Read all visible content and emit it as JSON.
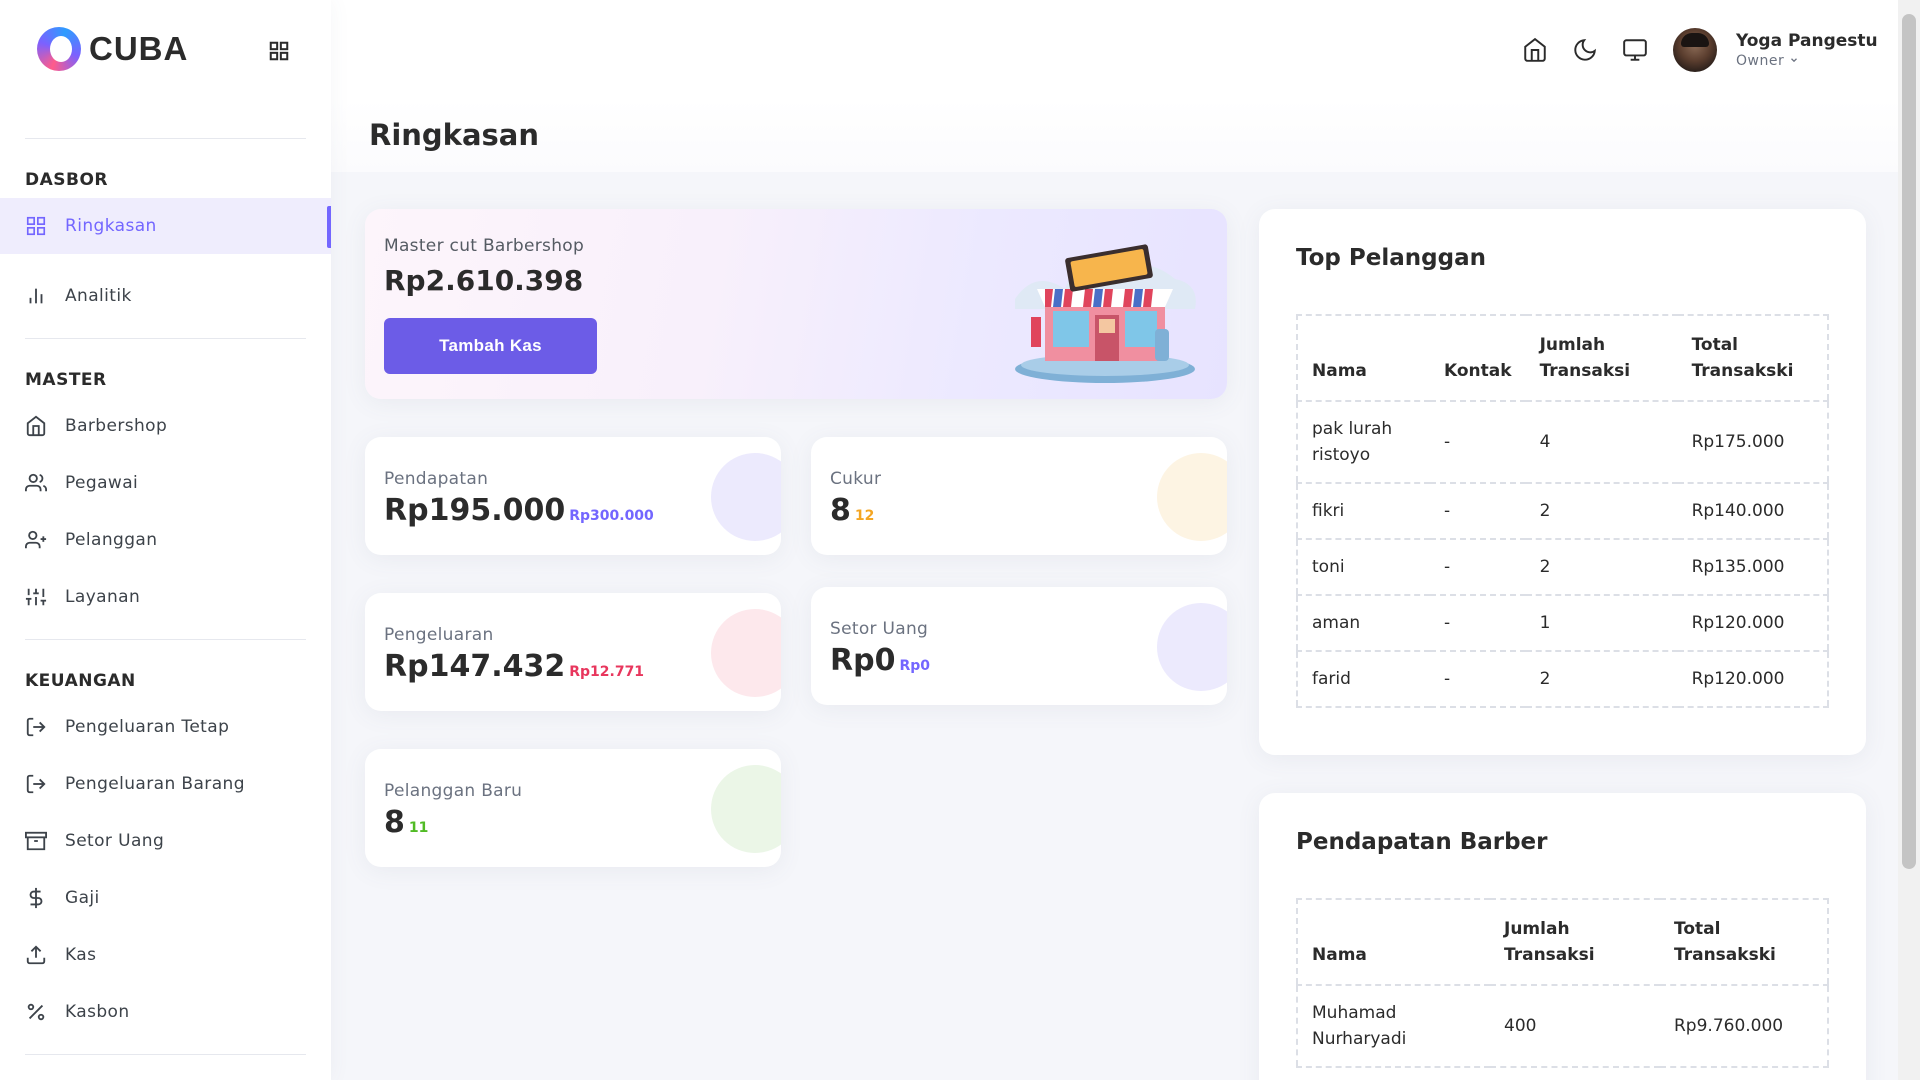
{
  "brand": {
    "name": "CUBA"
  },
  "sidebar": {
    "sections": [
      {
        "title": "DASBOR",
        "items": [
          {
            "label": "Ringkasan",
            "icon": "grid-icon",
            "active": true
          },
          {
            "label": "Analitik",
            "icon": "bar-chart-icon"
          }
        ]
      },
      {
        "title": "MASTER",
        "items": [
          {
            "label": "Barbershop",
            "icon": "home-icon"
          },
          {
            "label": "Pegawai",
            "icon": "users-icon"
          },
          {
            "label": "Pelanggan",
            "icon": "user-plus-icon"
          },
          {
            "label": "Layanan",
            "icon": "sliders-icon"
          }
        ]
      },
      {
        "title": "KEUANGAN",
        "items": [
          {
            "label": "Pengeluaran Tetap",
            "icon": "log-out-icon"
          },
          {
            "label": "Pengeluaran Barang",
            "icon": "log-out-icon"
          },
          {
            "label": "Setor Uang",
            "icon": "archive-icon"
          },
          {
            "label": "Gaji",
            "icon": "dollar-icon"
          },
          {
            "label": "Kas",
            "icon": "upload-icon"
          },
          {
            "label": "Kasbon",
            "icon": "percent-icon"
          }
        ]
      }
    ]
  },
  "header": {
    "user": {
      "name": "Yoga Pangestu",
      "role": "Owner"
    }
  },
  "page": {
    "title": "Ringkasan"
  },
  "hero": {
    "shop_name": "Master cut Barbershop",
    "balance": "Rp2.610.398",
    "button_label": "Tambah Kas"
  },
  "stats": {
    "pendapatan": {
      "label": "Pendapatan",
      "value": "Rp195.000",
      "sub": "Rp300.000",
      "sub_color": "#7366ff",
      "blob_color": "#eceafd"
    },
    "cukur": {
      "label": "Cukur",
      "value": "8",
      "sub": "12",
      "sub_color": "#f4a623",
      "blob_color": "#fdf4e3"
    },
    "pengeluaran": {
      "label": "Pengeluaran",
      "value": "Rp147.432",
      "sub": "Rp12.771",
      "sub_color": "#e8365d",
      "blob_color": "#fde8ec"
    },
    "setor_uang": {
      "label": "Setor Uang",
      "value": "Rp0",
      "sub": "Rp0",
      "sub_color": "#7366ff",
      "blob_color": "#eceafd"
    },
    "pelanggan_baru": {
      "label": "Pelanggan Baru",
      "value": "8",
      "sub": "11",
      "sub_color": "#51bb25",
      "blob_color": "#ebf6e7"
    }
  },
  "top_pelanggan": {
    "title": "Top Pelanggan",
    "columns": [
      "Nama",
      "Kontak",
      "Jumlah Transaksi",
      "Total Transakski"
    ],
    "rows": [
      [
        "pak lurah ristoyo",
        "-",
        "4",
        "Rp175.000"
      ],
      [
        "fikri",
        "-",
        "2",
        "Rp140.000"
      ],
      [
        "toni",
        "-",
        "2",
        "Rp135.000"
      ],
      [
        "aman",
        "-",
        "1",
        "Rp120.000"
      ],
      [
        "farid",
        "-",
        "2",
        "Rp120.000"
      ]
    ]
  },
  "pendapatan_barber": {
    "title": "Pendapatan Barber",
    "columns": [
      "Nama",
      "Jumlah Transaksi",
      "Total Transakski"
    ],
    "rows": [
      [
        "Muhamad Nurharyadi",
        "400",
        "Rp9.760.000"
      ]
    ]
  }
}
